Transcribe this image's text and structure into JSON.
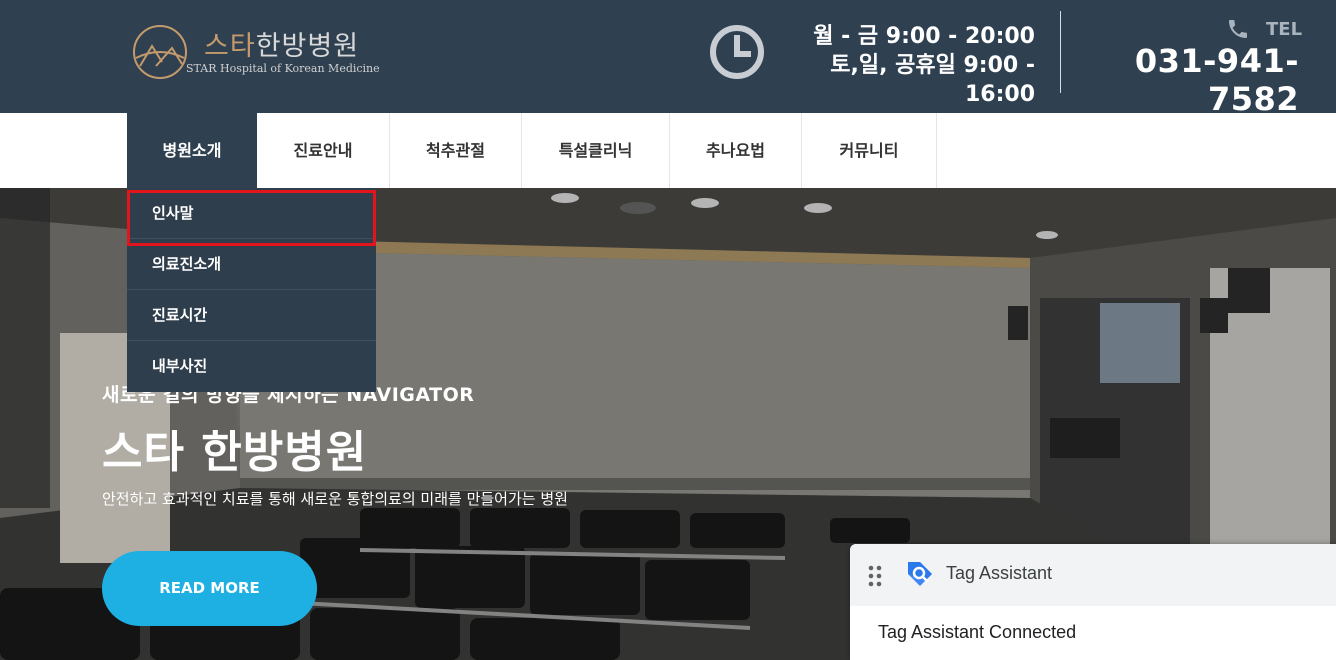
{
  "header": {
    "logo_title_brand": "스타",
    "logo_title_rest": "한방병원",
    "logo_subtitle": "STAR Hospital of Korean Medicine",
    "hours_weekday": "월 - 금 9:00 - 20:00",
    "hours_weekend": "토,일, 공휴일 9:00 - 16:00",
    "tel_label": "TEL",
    "tel_number": "031-941-7582"
  },
  "nav": {
    "items": [
      {
        "label": "병원소개"
      },
      {
        "label": "진료안내"
      },
      {
        "label": "척추관절"
      },
      {
        "label": "특설클리닉"
      },
      {
        "label": "추나요법"
      },
      {
        "label": "커뮤니티"
      }
    ],
    "active_index": 0
  },
  "dropdown": {
    "items": [
      {
        "label": "인사말"
      },
      {
        "label": "의료진소개"
      },
      {
        "label": "진료시간"
      },
      {
        "label": "내부사진"
      }
    ],
    "highlighted_index": 0
  },
  "hero": {
    "subtitle": "새로운 길의 방향을 제시하는 NAVIGATOR",
    "title": "스타 한방병원",
    "description": "안전하고 효과적인 치료를 통해 새로운 통합의료의 미래를 만들어가는 병원",
    "button_label": "READ MORE"
  },
  "tag_assistant": {
    "title": "Tag Assistant",
    "status": "Tag Assistant Connected"
  },
  "colors": {
    "header_bg": "#2f4050",
    "accent_button": "#1fb0e3",
    "highlight_border": "#e3141b",
    "logo_brand": "#c49a6c"
  }
}
